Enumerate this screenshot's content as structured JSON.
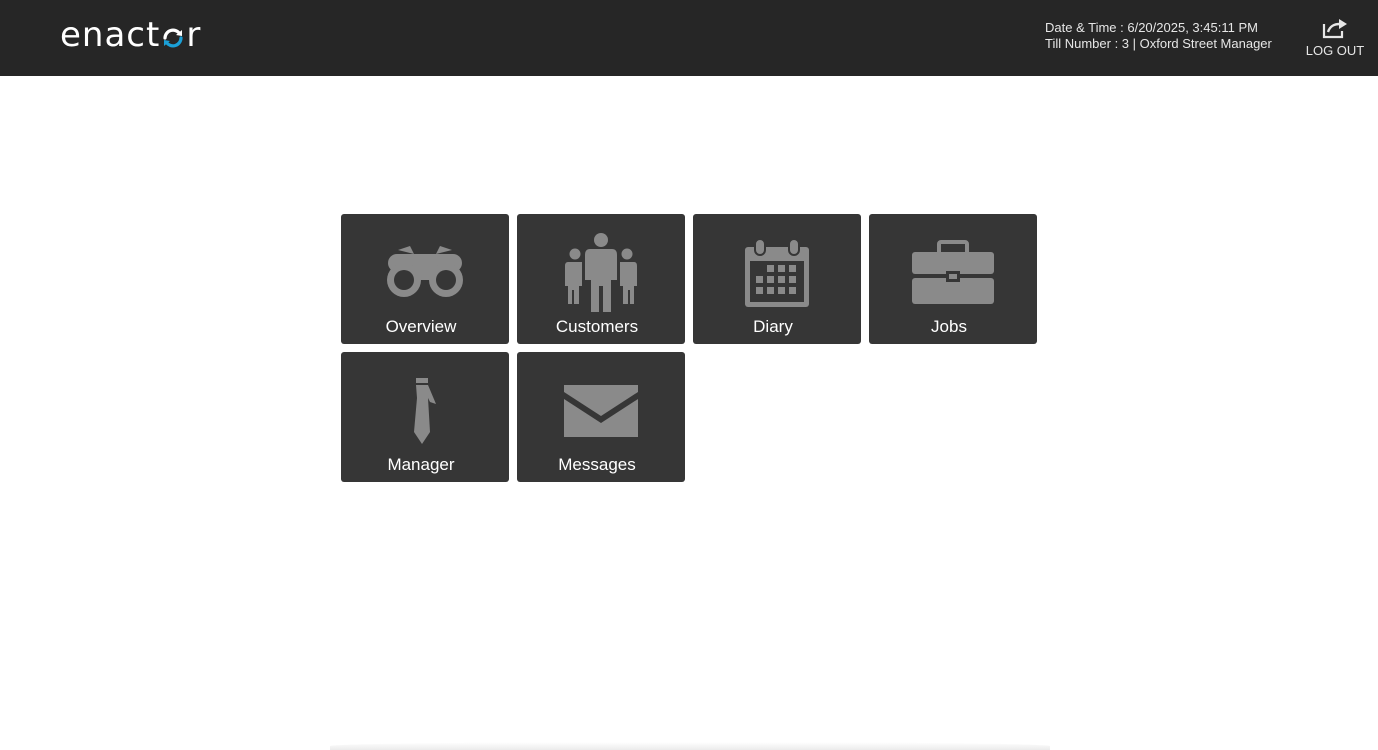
{
  "header": {
    "logo_left": "enact",
    "logo_right": "r",
    "datetime_label": "Date & Time : 6/20/2025, 3:45:11 PM",
    "till_label": "Till Number : 3 | Oxford Street Manager",
    "logout_label": "LOG OUT",
    "logout_icon": "share-export-icon"
  },
  "tiles": [
    {
      "label": "Overview",
      "icon": "binoculars-icon"
    },
    {
      "label": "Customers",
      "icon": "people-group-icon"
    },
    {
      "label": "Diary",
      "icon": "calendar-icon"
    },
    {
      "label": "Jobs",
      "icon": "briefcase-icon"
    },
    {
      "label": "Manager",
      "icon": "tie-icon"
    },
    {
      "label": "Messages",
      "icon": "envelope-icon"
    }
  ],
  "colors": {
    "header_bg": "#262626",
    "tile_bg": "#363636",
    "icon_fill": "#8a8a8a",
    "logo_accent": "#1ba0d7"
  }
}
